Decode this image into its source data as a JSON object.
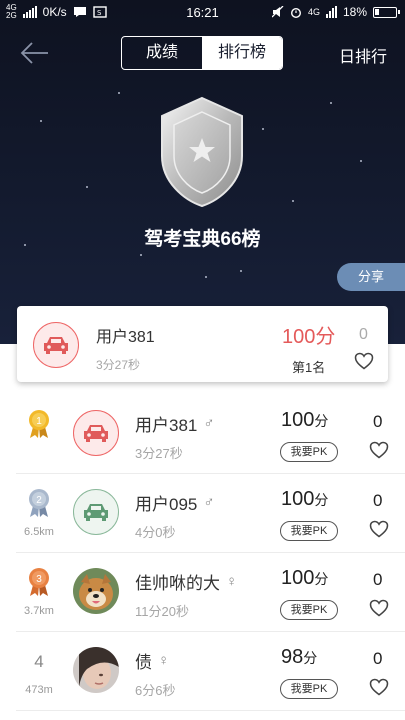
{
  "status_bar": {
    "network_top": "4G",
    "network_bottom": "2G",
    "speed": "0K/s",
    "time": "16:21",
    "network_right": "4G",
    "battery": "18%"
  },
  "nav": {
    "tab_scores": "成绩",
    "tab_ranking": "排行榜",
    "daily_ranking": "日排行"
  },
  "hero": {
    "title": "驾考宝典66榜",
    "share": "分享"
  },
  "my_card": {
    "name": "用户381",
    "time": "3分27秒",
    "score": "100分",
    "position": "第1名",
    "likes": "0"
  },
  "list": [
    {
      "rank": "",
      "distance": "",
      "name": "用户381",
      "gender": "♂",
      "time": "3分27秒",
      "score": "100",
      "unit": "分",
      "pk": "我要PK",
      "likes": "0"
    },
    {
      "rank": "",
      "distance": "6.5km",
      "name": "用户095",
      "gender": "♂",
      "time": "4分0秒",
      "score": "100",
      "unit": "分",
      "pk": "我要PK",
      "likes": "0"
    },
    {
      "rank": "",
      "distance": "3.7km",
      "name": "佳帅咻的大",
      "gender": "♀",
      "time": "11分20秒",
      "score": "100",
      "unit": "分",
      "pk": "我要PK",
      "likes": "0"
    },
    {
      "rank": "4",
      "distance": "473m",
      "name": "债",
      "gender": "♀",
      "time": "6分6秒",
      "score": "98",
      "unit": "分",
      "pk": "我要PK",
      "likes": "0"
    }
  ],
  "colors": {
    "hero_bg": "#131a2e",
    "accent_red": "#e45a5a",
    "share_bg": "#6c8db5",
    "gold": "#e6a91c",
    "silver": "#9fb0c8",
    "bronze": "#e07a3a"
  }
}
